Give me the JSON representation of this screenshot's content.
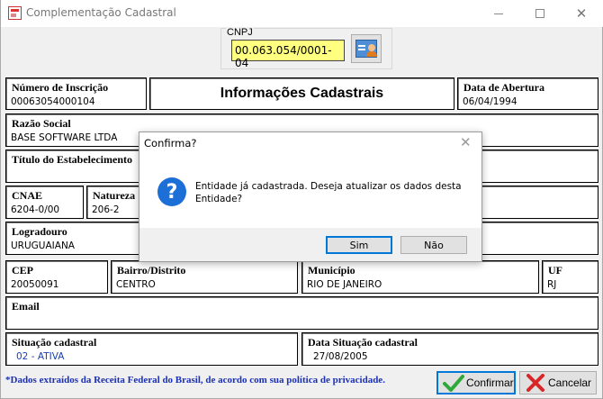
{
  "window": {
    "title": "Complementação Cadastral"
  },
  "cnpj": {
    "label": "CNPJ",
    "value": "00.063.054/0001-04"
  },
  "header": {
    "title": "Informações Cadastrais"
  },
  "fields": {
    "numero_inscricao": {
      "label": "Número de Inscrição",
      "value": "00063054000104"
    },
    "data_abertura": {
      "label": "Data de Abertura",
      "value": "06/04/1994"
    },
    "razao_social": {
      "label": "Razão Social",
      "value": "BASE SOFTWARE LTDA"
    },
    "titulo_estabelecimento": {
      "label": "Título do Estabelecimento",
      "value": ""
    },
    "cnae": {
      "label": "CNAE",
      "value": "6204-0/00"
    },
    "natureza": {
      "label": "Natureza",
      "value": "206-2"
    },
    "logradouro": {
      "label": "Logradouro",
      "value": "URUGUAIANA"
    },
    "cep": {
      "label": "CEP",
      "value": "20050091"
    },
    "bairro": {
      "label": "Bairro/Distrito",
      "value": "CENTRO"
    },
    "municipio": {
      "label": "Município",
      "value": "RIO DE JANEIRO"
    },
    "uf": {
      "label": "UF",
      "value": "RJ"
    },
    "email": {
      "label": "Email",
      "value": ""
    },
    "situacao": {
      "label": "Situação cadastral",
      "value": "02 - ATIVA"
    },
    "data_situacao": {
      "label": "Data Situação cadastral",
      "value": "27/08/2005"
    }
  },
  "footer": {
    "notice": "*Dados extraídos da Receita Federal do Brasil, de acordo com sua política de privacidade.",
    "confirm_label": "Confirmar",
    "cancel_label": "Cancelar"
  },
  "dialog": {
    "title": "Confirma?",
    "message": "Entidade já cadastrada. Deseja atualizar os dados desta Entidade?",
    "yes_label": "Sim",
    "no_label": "Não"
  },
  "colors": {
    "cnpj_bg": "#ffff80",
    "notice": "#1a2fb8",
    "focus": "#0078d7"
  }
}
